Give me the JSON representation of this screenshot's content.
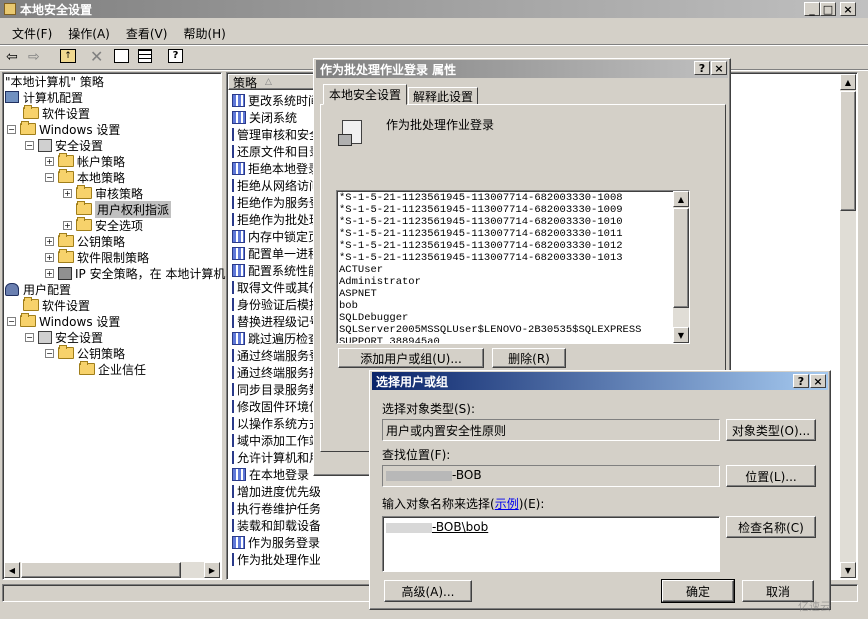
{
  "main_window": {
    "title": "本地安全设置",
    "caption_buttons": [
      "_",
      "□",
      "×"
    ],
    "menu": [
      "文件(F)",
      "操作(A)",
      "查看(V)",
      "帮助(H)"
    ],
    "toolbar_icons": [
      "back-arrow-icon",
      "forward-arrow-icon",
      "up-folder-icon",
      "delete-icon",
      "properties-icon",
      "export-list-icon",
      "help-icon"
    ]
  },
  "tree": {
    "root": "\"本地计算机\" 策略",
    "items": [
      {
        "label": "计算机配置"
      },
      {
        "label": "软件设置"
      },
      {
        "label": "Windows 设置"
      },
      {
        "label": "安全设置"
      },
      {
        "label": "帐户策略"
      },
      {
        "label": "本地策略"
      },
      {
        "label": "审核策略"
      },
      {
        "label": "用户权利指派"
      },
      {
        "label": "安全选项"
      },
      {
        "label": "公钥策略"
      },
      {
        "label": "软件限制策略"
      },
      {
        "label": "IP 安全策略，在 本地计算机"
      },
      {
        "label": "用户配置"
      },
      {
        "label": "软件设置"
      },
      {
        "label": "Windows 设置"
      },
      {
        "label": "安全设置"
      },
      {
        "label": "公钥策略"
      },
      {
        "label": "企业信任"
      }
    ]
  },
  "list": {
    "column_header": "策略",
    "rows": [
      "更改系统时间",
      "关闭系统",
      "管理审核和安全日志",
      "还原文件和目录",
      "拒绝本地登录",
      "拒绝从网络访问",
      "拒绝作为服务登录",
      "拒绝作为批处理作业登录",
      "内存中锁定页",
      "配置单一进程",
      "配置系统性能",
      "取得文件或其他对象",
      "身份验证后模拟客户端",
      "替换进程级记号",
      "跳过遍历检查",
      "通过终端服务登录",
      "通过终端服务拒绝登录",
      "同步目录服务数据",
      "修改固件环境值",
      "以操作系统方式操作",
      "域中添加工作站",
      "允许计算机和用户帐户",
      "在本地登录",
      "增加进度优先级",
      "执行卷维护任务",
      "装载和卸载设备驱动程序",
      "作为服务登录",
      "作为批处理作业登录"
    ]
  },
  "props_dialog": {
    "title": "作为批处理作业登录 属性",
    "caption_buttons": [
      "?",
      "×"
    ],
    "tabs": [
      "本地安全设置",
      "解释此设置"
    ],
    "heading": "作为批处理作业登录",
    "members": [
      "*S-1-5-21-1123561945-113007714-682003330-1008",
      "*S-1-5-21-1123561945-113007714-682003330-1009",
      "*S-1-5-21-1123561945-113007714-682003330-1010",
      "*S-1-5-21-1123561945-113007714-682003330-1011",
      "*S-1-5-21-1123561945-113007714-682003330-1012",
      "*S-1-5-21-1123561945-113007714-682003330-1013",
      "ACTUser",
      "Administrator",
      "ASPNET",
      "bob",
      "SQLDebugger",
      "SQLServer2005MSSQLUser$LENOVO-2B30535$SQLEXPRESS",
      "SUPPORT_388945a0"
    ],
    "add_button": "添加用户或组(U)...",
    "remove_button": "删除(R)"
  },
  "select_dialog": {
    "title": "选择用户或组",
    "caption_buttons": [
      "?",
      "×"
    ],
    "object_type_label": "选择对象类型(S):",
    "object_type_value": "用户或内置安全性原则",
    "object_type_button": "对象类型(O)...",
    "location_label": "查找位置(F):",
    "location_value": "-BOB",
    "location_button": "位置(L)...",
    "names_label_prefix": "输入对象名称来选择(",
    "names_label_link": "示例",
    "names_label_suffix": ")(E):",
    "names_value": "-BOB\\bob",
    "check_names_button": "检查名称(C)",
    "advanced_button": "高级(A)...",
    "ok_button": "确定",
    "cancel_button": "取消"
  },
  "watermark": "亿速云"
}
